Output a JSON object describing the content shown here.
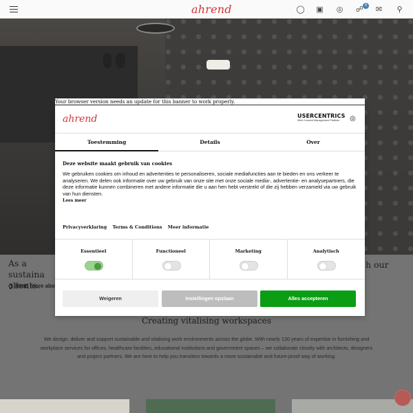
{
  "header": {
    "logo_text": "ahrend",
    "icons": [
      "menu-icon",
      "user-icon",
      "contact-card-icon",
      "globe-icon",
      "cart-icon",
      "mail-icon",
      "search-icon"
    ],
    "cart_count": "0"
  },
  "hero": {
    "tagline_left": "As a sustaina",
    "tagline_left_line2": "clients.",
    "tagline_right": "h our",
    "read_more": "Read more about"
  },
  "section": {
    "title": "Creating vitalising workspaces",
    "body": "We design, deliver and support sustainable and vitalising work environments across the globe. With nearly 130 years of expertise in furnishing and workplace services for offices, healthcare facilities, educational institutions and government spaces – we collaborate closely with architects, designers and project partners. We are here to help you transition towards a more sustainable and future-proof way of working."
  },
  "consent": {
    "outdated_notice": "Your browser version needs an update for this banner to work properly.",
    "logo_text": "ahrend",
    "provider_brand": "USERCENTRICS",
    "provider_sub": "Web Consent Management Platform",
    "tabs": [
      "Toestemming",
      "Details",
      "Over"
    ],
    "active_tab": "Toestemming",
    "title": "Deze website maakt gebruik van cookies",
    "text": "We gebruiken cookies om inhoud en advertenties te personaliseren, sociale mediafuncties aan te bieden en ons verkeer te analyseren. We delen ook informatie over uw gebruik van onze site met onze sociale media-, advertentie- en analysepartners, die deze informatie kunnen combineren met andere informatie die u aan hen hebt verstrekt of die zij hebben verzameld via uw gebruik van hun diensten.",
    "read_more": "Lees meer",
    "links": [
      "Privacyverklaring",
      "Terms & Conditions",
      "Meer informatie"
    ],
    "categories": [
      {
        "label": "Essentieel",
        "on": true
      },
      {
        "label": "Functioneel",
        "on": false
      },
      {
        "label": "Marketing",
        "on": false
      },
      {
        "label": "Analytisch",
        "on": false
      }
    ],
    "buttons": {
      "deny": "Weigeren",
      "save": "Instellingen opslaan",
      "accept": "Alles accepteren"
    },
    "colors": {
      "accept": "#0b9d14",
      "toggle_on": "#4c9a45",
      "brand": "#d0343a"
    }
  }
}
